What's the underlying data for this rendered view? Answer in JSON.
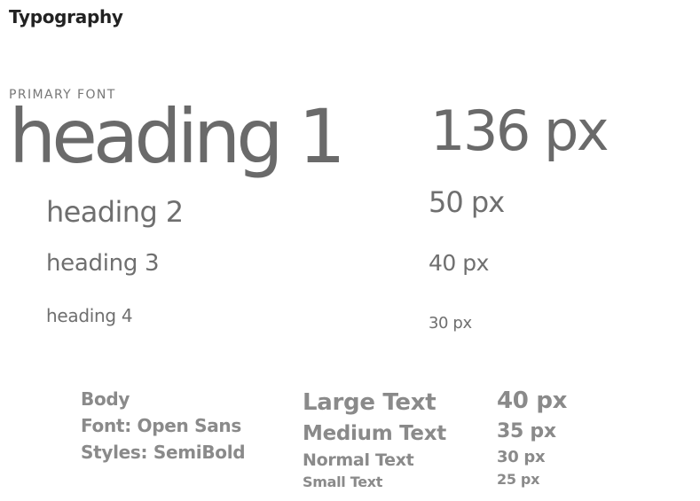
{
  "page": {
    "title": "Typography",
    "section_label": "PRIMARY FONT"
  },
  "headings": [
    {
      "label": "heading 1",
      "size": "136 px"
    },
    {
      "label": "heading 2",
      "size": "50 px"
    },
    {
      "label": "heading 3",
      "size": "40 px"
    },
    {
      "label": "heading 4",
      "size": "30 px"
    }
  ],
  "body": {
    "title": "Body",
    "font": "Font: Open Sans",
    "styles": "Styles: SemiBold"
  },
  "text_sizes": [
    {
      "label": "Large Text",
      "size": "40 px"
    },
    {
      "label": "Medium Text",
      "size": "35 px"
    },
    {
      "label": "Normal Text",
      "size": "30 px"
    },
    {
      "label": "Small Text",
      "size": "25 px"
    }
  ]
}
